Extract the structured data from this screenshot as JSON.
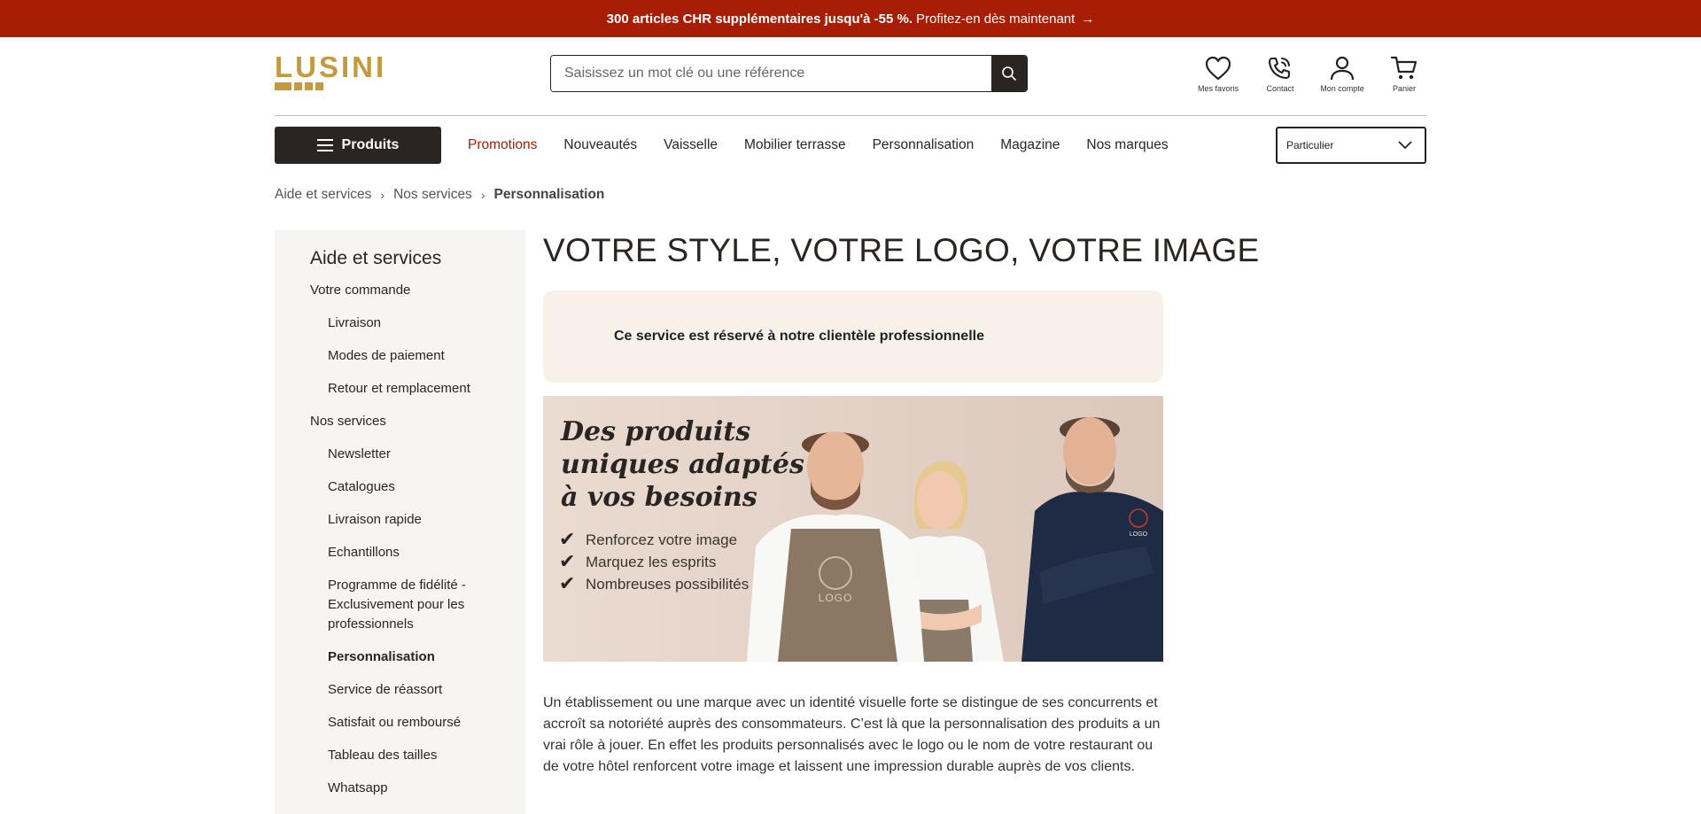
{
  "promo_bar": {
    "bold_text": "300 articles CHR supplémentaires jusqu'à -55 %.",
    "link_text": "Profitez-en dès maintenant",
    "arrow": "→"
  },
  "header": {
    "logo_text": "LUSINI",
    "search_placeholder": "Saisissez un mot clé ou une référence",
    "icons": [
      {
        "icon": "heart-icon",
        "label": "Mes favoris"
      },
      {
        "icon": "phone-icon",
        "label": "Contact"
      },
      {
        "icon": "user-icon",
        "label": "Mon compte"
      },
      {
        "icon": "cart-icon",
        "label": "Panier"
      }
    ]
  },
  "nav": {
    "products_label": "Produits",
    "links": [
      "Promotions",
      "Nouveautés",
      "Vaisselle",
      "Mobilier terrasse",
      "Personnalisation",
      "Magazine",
      "Nos marques"
    ],
    "customer_type": "Particulier"
  },
  "breadcrumb": [
    "Aide et services",
    "Nos services",
    "Personnalisation"
  ],
  "sidebar": {
    "title": "Aide et services",
    "items": [
      {
        "label": "Votre commande",
        "level": 1
      },
      {
        "label": "Livraison",
        "level": 2
      },
      {
        "label": "Modes de paiement",
        "level": 2
      },
      {
        "label": "Retour et remplacement",
        "level": 2
      },
      {
        "label": "Nos services",
        "level": 1
      },
      {
        "label": "Newsletter",
        "level": 2
      },
      {
        "label": "Catalogues",
        "level": 2
      },
      {
        "label": "Livraison rapide",
        "level": 2
      },
      {
        "label": "Echantillons",
        "level": 2
      },
      {
        "label": "Programme de fidélité - Exclusivement pour les professionnels",
        "level": 2
      },
      {
        "label": "Personnalisation",
        "level": 2,
        "active": true
      },
      {
        "label": "Service de réassort",
        "level": 2
      },
      {
        "label": "Satisfait ou remboursé",
        "level": 2
      },
      {
        "label": "Tableau des tailles",
        "level": 2
      },
      {
        "label": "Whatsapp",
        "level": 2
      }
    ]
  },
  "main": {
    "title": "VOTRE STYLE, VOTRE LOGO, VOTRE IMAGE",
    "notice": "Ce service est réservé à notre clientèle professionnelle",
    "banner": {
      "headline": "Des produits uniques adaptés à vos besoins",
      "bullets": [
        "Renforcez votre image",
        "Marquez les esprits",
        "Nombreuses possibilités"
      ],
      "apron_logo": "LOGO",
      "jacket_logo": "LOGO"
    },
    "paragraph": "Un établissement ou une marque avec un identité visuelle forte se distingue de ses concurrents et accroît sa notoriété auprès des consommateurs. C’est là que la personnalisation des produits a un vrai rôle à jouer. En effet les produits personnalisés avec le logo ou le nom de votre restaurant ou de votre hôtel renforcent votre image et laissent une impression durable auprès de vos clients."
  },
  "colors": {
    "promo_bg": "#a81d06",
    "brand_gold": "#c59a3e",
    "dark": "#2a2522",
    "notice_bg": "#f7f1e9",
    "sidebar_bg": "#f6f5f3",
    "banner_bg": "#e8d6cb"
  }
}
